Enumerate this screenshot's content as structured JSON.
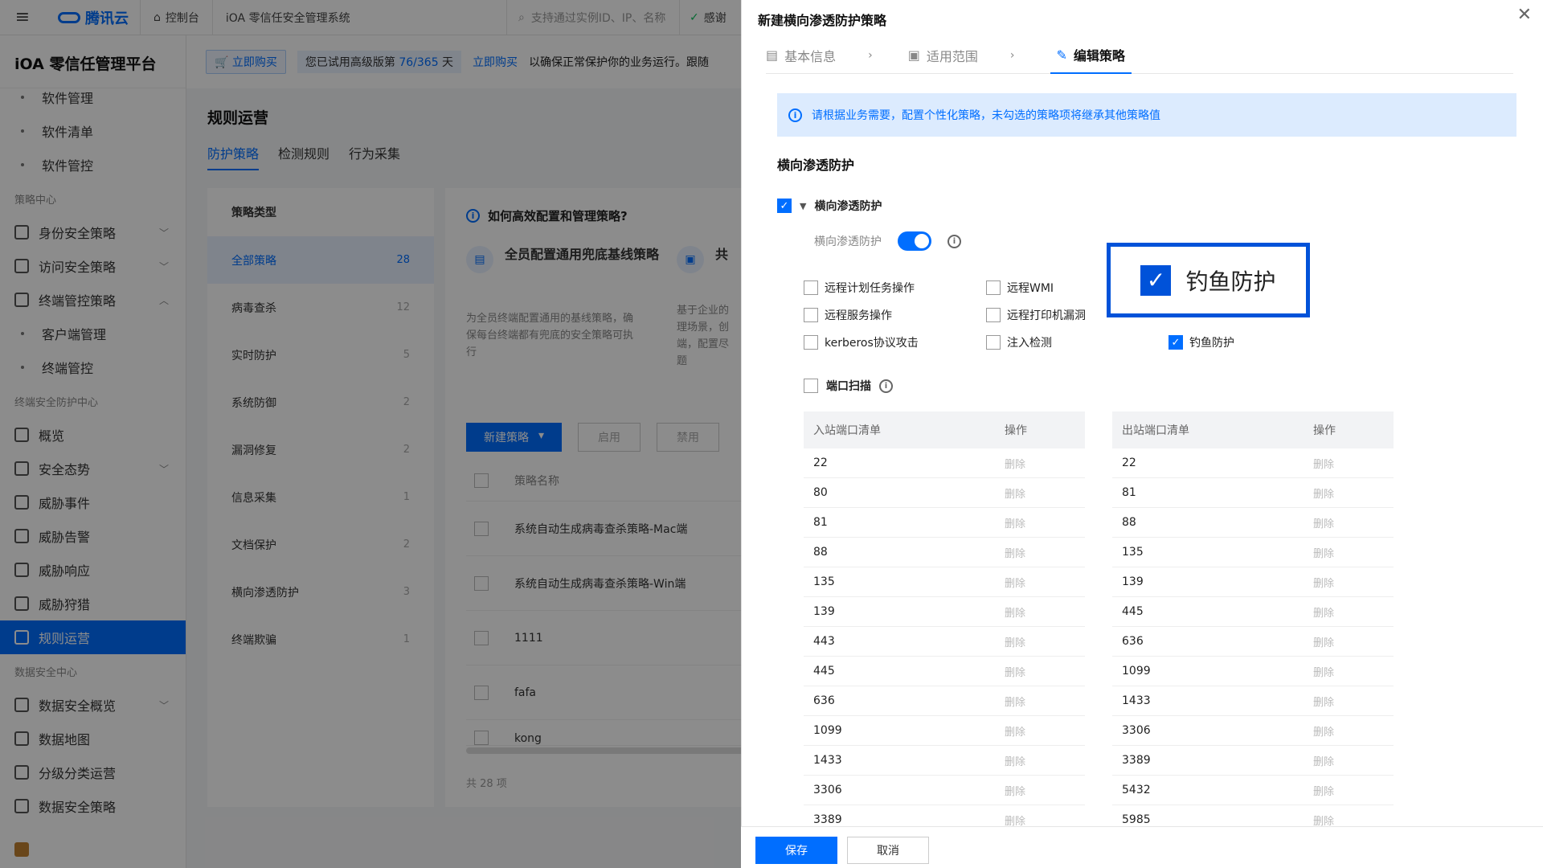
{
  "topbar": {
    "brand": "腾讯云",
    "console": "控制台",
    "product": "iOA 零信任安全管理系统",
    "search_placeholder": "支持通过实例ID、IP、名称",
    "status": "感谢"
  },
  "sidebar": {
    "platform": "iOA 零信任管理平台",
    "items": [
      {
        "type": "sub",
        "label": "软件管理"
      },
      {
        "type": "sub",
        "label": "软件清单"
      },
      {
        "type": "sub",
        "label": "软件管控"
      },
      {
        "type": "group",
        "label": "策略中心"
      },
      {
        "type": "item",
        "label": "身份安全策略",
        "chev": "v"
      },
      {
        "type": "item",
        "label": "访问安全策略",
        "chev": "v"
      },
      {
        "type": "item",
        "label": "终端管控策略",
        "chev": "^"
      },
      {
        "type": "sub",
        "label": "客户端管理"
      },
      {
        "type": "sub",
        "label": "终端管控"
      },
      {
        "type": "group",
        "label": "终端安全防护中心"
      },
      {
        "type": "item",
        "label": "概览"
      },
      {
        "type": "item",
        "label": "安全态势",
        "chev": "v"
      },
      {
        "type": "item",
        "label": "威胁事件"
      },
      {
        "type": "item",
        "label": "威胁告警"
      },
      {
        "type": "item",
        "label": "威胁响应"
      },
      {
        "type": "item",
        "label": "威胁狩猎"
      },
      {
        "type": "item",
        "label": "规则运营",
        "active": true
      },
      {
        "type": "group",
        "label": "数据安全中心"
      },
      {
        "type": "item",
        "label": "数据安全概览",
        "chev": "v"
      },
      {
        "type": "item",
        "label": "数据地图"
      },
      {
        "type": "item",
        "label": "分级分类运营"
      },
      {
        "type": "item",
        "label": "数据安全策略"
      }
    ]
  },
  "promo": {
    "buy": "立即购买",
    "trial_prefix": "您已试用高级版第 ",
    "trial_num": "76/365",
    "trial_suffix": " 天",
    "link": "立即购买",
    "text": "以确保正常保护你的业务运行。跟随"
  },
  "main": {
    "title": "规则运营",
    "tabs": [
      "防护策略",
      "检测规则",
      "行为采集"
    ],
    "category_header": "策略类型",
    "categories": [
      {
        "label": "全部策略",
        "count": "28",
        "active": true
      },
      {
        "label": "病毒查杀",
        "count": "12"
      },
      {
        "label": "实时防护",
        "count": "5"
      },
      {
        "label": "系统防御",
        "count": "2"
      },
      {
        "label": "漏洞修复",
        "count": "2"
      },
      {
        "label": "信息采集",
        "count": "1"
      },
      {
        "label": "文档保护",
        "count": "2"
      },
      {
        "label": "横向渗透防护",
        "count": "3"
      },
      {
        "label": "终端欺骗",
        "count": "1"
      }
    ],
    "howto": "如何高效配置和管理策略?",
    "card1_title": "全员配置通用兜底基线策略",
    "card1_desc": [
      "为全员终端配置通用的基线策略，确",
      "保每台终端都有兜底的安全策略可执",
      "行"
    ],
    "card2_title": "共",
    "card2_desc": [
      "基于企业的",
      "理场景，创",
      "端，配置尽",
      "题"
    ],
    "new_btn": "新建策略",
    "enable_btn": "启用",
    "disable_btn": "禁用",
    "col_name": "策略名称",
    "rows": [
      "系统自动生成病毒查杀策略-Mac端",
      "系统自动生成病毒查杀策略-Win端",
      "1111",
      "fafa",
      "kong"
    ],
    "total": "共 28 项"
  },
  "drawer": {
    "title": "新建横向渗透防护策略",
    "steps": [
      "基本信息",
      "适用范围",
      "编辑策略"
    ],
    "notice": "请根据业务需要，配置个性化策略，未勾选的策略项将继承其他策略值",
    "section": "横向渗透防护",
    "master_label": "横向渗透防护",
    "toggle_label": "横向渗透防护",
    "options": [
      {
        "label": "远程计划任务操作",
        "checked": false
      },
      {
        "label": "远程WMI",
        "checked": false
      },
      {
        "label": "远程服务操作",
        "checked": false
      },
      {
        "label": "远程打印机漏洞",
        "checked": false
      },
      {
        "label": "kerberos协议攻击",
        "checked": false
      },
      {
        "label": "注入检测",
        "checked": false
      },
      {
        "label": "钓鱼防护",
        "checked": true
      }
    ],
    "callout_label": "钓鱼防护",
    "port_scan": "端口扫描",
    "inbound_header": "入站端口清单",
    "outbound_header": "出站端口清单",
    "op_header": "操作",
    "delete": "删除",
    "inbound": [
      "22",
      "80",
      "81",
      "88",
      "135",
      "139",
      "443",
      "445",
      "636",
      "1099",
      "1433",
      "3306",
      "3389"
    ],
    "outbound": [
      "22",
      "81",
      "88",
      "135",
      "139",
      "445",
      "636",
      "1099",
      "1433",
      "3306",
      "3389",
      "5432",
      "5985"
    ],
    "save": "保存",
    "cancel": "取消"
  },
  "colors": {
    "accent": "#006eff",
    "callout_border": "#0052d9"
  }
}
